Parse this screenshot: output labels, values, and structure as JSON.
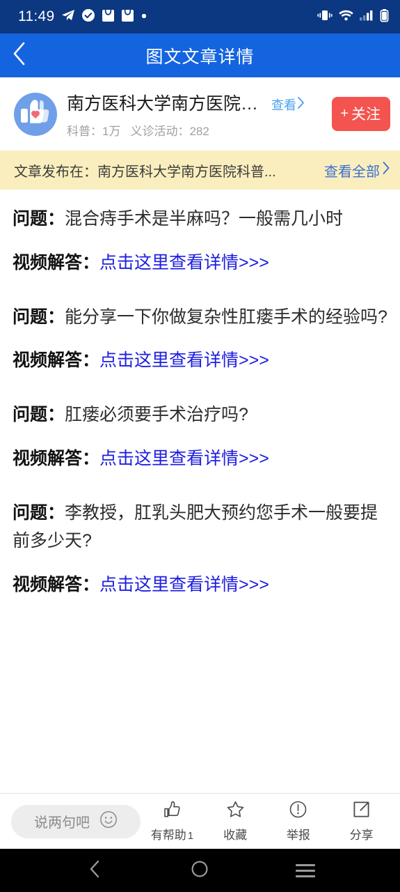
{
  "status_bar": {
    "time": "11:49",
    "left_icons": [
      "telegram-icon",
      "check-circle-icon",
      "bag-icon",
      "bag-icon",
      "dot-icon"
    ],
    "right_icons": [
      "vibrate-icon",
      "wifi-icon",
      "signal-icon",
      "battery-icon"
    ],
    "background": "#0c3781"
  },
  "title_bar": {
    "title": "图文文章详情",
    "back_icon": "chevron-left-icon",
    "background": "#1464e0"
  },
  "account": {
    "avatar_icon": "thumbs-up-heart-icon",
    "name": "南方医科大学南方医院科...",
    "view_label": "查看",
    "view_chevron": "chevron-right-icon",
    "stat1_label": "科普：",
    "stat1_value": "1万",
    "stat2_label": "义诊活动：",
    "stat2_value": "282",
    "follow_plus": "+",
    "follow_label": "关注",
    "follow_color": "#f4544f"
  },
  "source_bar": {
    "text": "文章发布在：南方医科大学南方医院科普...",
    "view_all_label": "查看全部",
    "view_all_chevron": "chevron-right-icon",
    "background": "#faeebe",
    "link_color": "#3d6fd1"
  },
  "article": {
    "question_prefix": "问题：",
    "answer_prefix": "视频解答：",
    "link_color": "#1d1de0",
    "blocks": [
      {
        "question": "混合痔手术是半麻吗？一般需几小时",
        "answer_link": "点击这里查看详情>>>"
      },
      {
        "question": "能分享一下你做复杂性肛瘘手术的经验吗?",
        "answer_link": "点击这里查看详情>>>"
      },
      {
        "question": "肛瘘必须要手术治疗吗?",
        "answer_link": "点击这里查看详情>>>"
      },
      {
        "question": "李教授，肛乳头肥大预约您手术一般要提前多少天?",
        "answer_link": "点击这里查看详情>>>"
      }
    ]
  },
  "action_bar": {
    "comment_placeholder": "说两句吧",
    "emoji_icon": "smiley-icon",
    "actions": [
      {
        "icon": "thumbs-up-icon",
        "label": "有帮助",
        "count": "1"
      },
      {
        "icon": "star-icon",
        "label": "收藏",
        "count": ""
      },
      {
        "icon": "exclamation-circle-icon",
        "label": "举报",
        "count": ""
      },
      {
        "icon": "share-arrow-icon",
        "label": "分享",
        "count": ""
      }
    ]
  },
  "nav_bar": {
    "back_icon": "chevron-left-icon",
    "home_icon": "circle-icon",
    "recents_icon": "hamburger-icon"
  }
}
